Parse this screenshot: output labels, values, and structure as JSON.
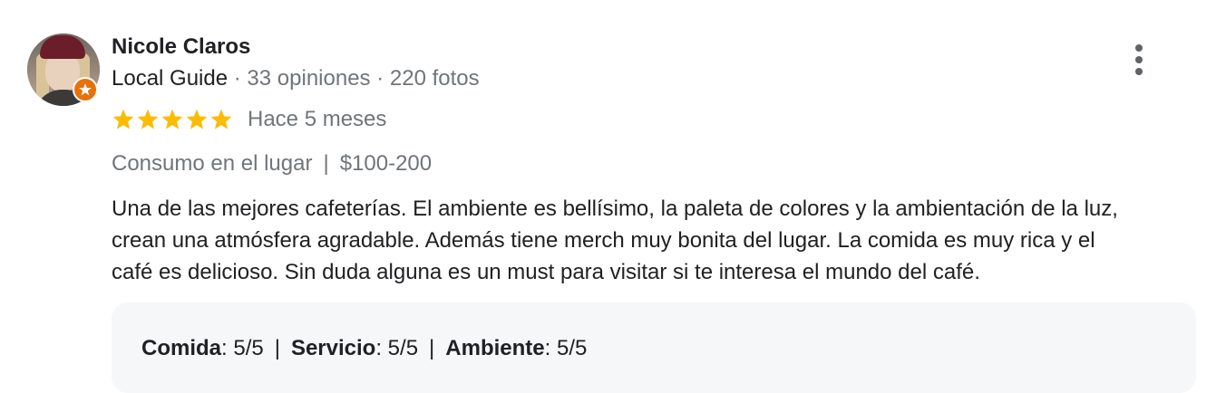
{
  "reviewer": {
    "name": "Nicole Claros",
    "badge": "Local Guide",
    "reviews_count": "33 opiniones",
    "photos_count": "220 fotos",
    "meta_separator": " · "
  },
  "rating": {
    "stars": 5,
    "max_stars": 5,
    "star_color": "#fbbc04",
    "date": "Hace 5 meses"
  },
  "visit": {
    "type": "Consumo en el lugar",
    "separator": "|",
    "price": "$100-200"
  },
  "review": {
    "lines": [
      "Una de las mejores cafeterías. El ambiente es bellísimo, la paleta de colores y la ambientación de la luz,",
      "crean una atmósfera agradable. Además tiene merch muy bonita del lugar. La comida es muy rica y el",
      "café es delicioso. Sin duda alguna es un must para visitar si te interesa el mundo del café."
    ]
  },
  "subratings": {
    "separator": "|",
    "items": [
      {
        "label": "Comida",
        "value": ": 5/5"
      },
      {
        "label": "Servicio",
        "value": ": 5/5"
      },
      {
        "label": "Ambiente",
        "value": ": 5/5"
      }
    ]
  },
  "icons": {
    "more": "more-vert-icon",
    "star": "star-icon",
    "badge": "local-guide-badge-icon"
  },
  "colors": {
    "badge": "#e8710a",
    "secondary_text": "#70757a",
    "subratings_bg": "#f6f7f8"
  }
}
